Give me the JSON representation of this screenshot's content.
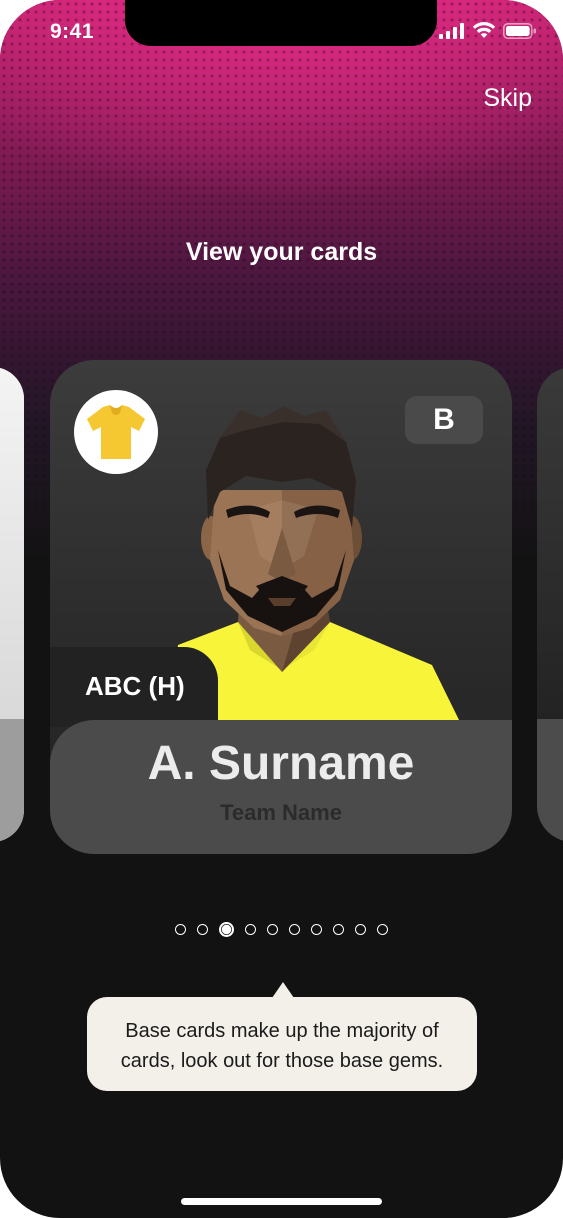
{
  "status_bar": {
    "time": "9:41"
  },
  "header": {
    "skip_label": "Skip"
  },
  "title": "View your cards",
  "card": {
    "rarity": "B",
    "position": "ABC (H)",
    "player_name": "A. Surname",
    "team_name": "Team Name",
    "kit_color": "#f5c832",
    "shirt_color": "#f7f43a"
  },
  "pagination": {
    "total": 10,
    "current_index": 2
  },
  "tooltip": {
    "line1": "Base cards make up the majority of",
    "line2": "cards, look out for those base gems."
  },
  "colors": {
    "accent": "#c0226d",
    "background": "#131213"
  }
}
